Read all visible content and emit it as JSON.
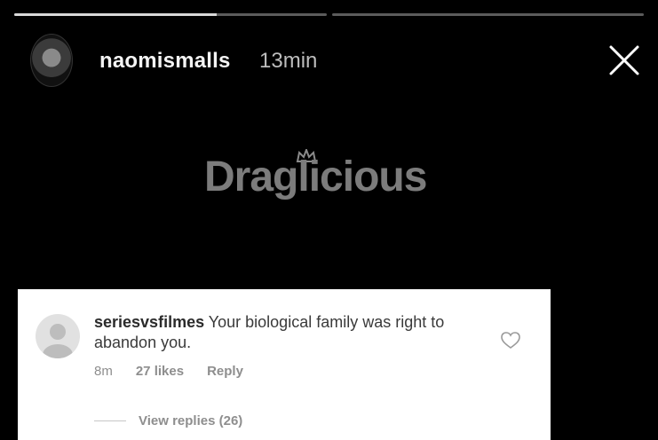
{
  "story": {
    "progress": [
      1.0,
      0.0
    ],
    "progress_first_fill": 0.65
  },
  "header": {
    "username": "naomismalls",
    "timestamp": "13min",
    "close_icon": "close-icon"
  },
  "watermark": {
    "text": "Draglicious"
  },
  "comment": {
    "username": "seriesvsfilmes",
    "text": "Your biological family was right to abandon you.",
    "age": "8m",
    "likes": "27 likes",
    "reply_label": "Reply",
    "view_replies": "View replies (26)"
  },
  "colors": {
    "background": "#000000",
    "card": "#ffffff",
    "meta": "#8e8e8e"
  }
}
